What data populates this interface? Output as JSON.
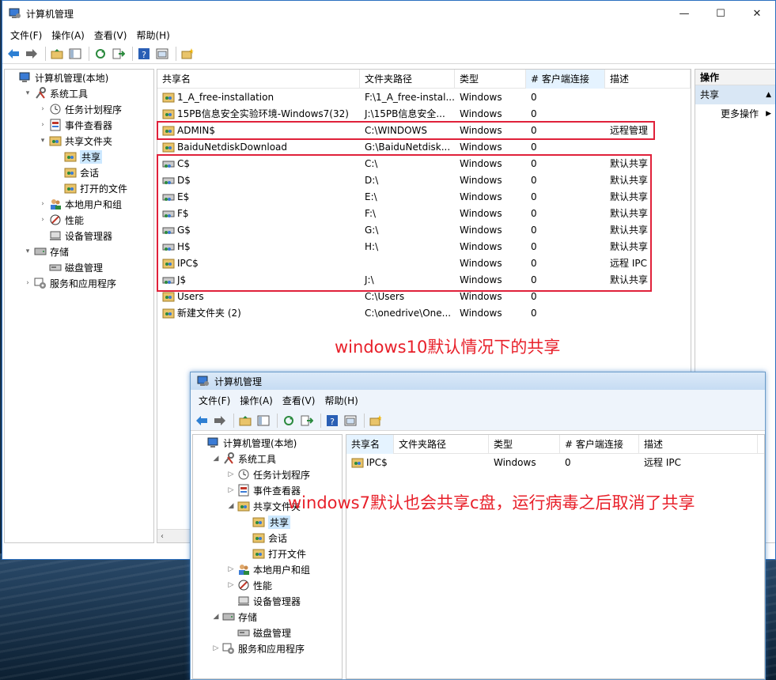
{
  "w10": {
    "title": "计算机管理",
    "menu": [
      "文件(F)",
      "操作(A)",
      "查看(V)",
      "帮助(H)"
    ],
    "tree": [
      {
        "label": "计算机管理(本地)",
        "indent": 0,
        "arrow": "",
        "icon": "computer"
      },
      {
        "label": "系统工具",
        "indent": 1,
        "arrow": "▾",
        "icon": "tools"
      },
      {
        "label": "任务计划程序",
        "indent": 2,
        "arrow": "›",
        "icon": "clock"
      },
      {
        "label": "事件查看器",
        "indent": 2,
        "arrow": "›",
        "icon": "event"
      },
      {
        "label": "共享文件夹",
        "indent": 2,
        "arrow": "▾",
        "icon": "share"
      },
      {
        "label": "共享",
        "indent": 3,
        "arrow": "",
        "icon": "share",
        "selected": true
      },
      {
        "label": "会话",
        "indent": 3,
        "arrow": "",
        "icon": "share"
      },
      {
        "label": "打开的文件",
        "indent": 3,
        "arrow": "",
        "icon": "share"
      },
      {
        "label": "本地用户和组",
        "indent": 2,
        "arrow": "›",
        "icon": "users"
      },
      {
        "label": "性能",
        "indent": 2,
        "arrow": "›",
        "icon": "perf"
      },
      {
        "label": "设备管理器",
        "indent": 2,
        "arrow": "",
        "icon": "device"
      },
      {
        "label": "存储",
        "indent": 1,
        "arrow": "▾",
        "icon": "storage"
      },
      {
        "label": "磁盘管理",
        "indent": 2,
        "arrow": "",
        "icon": "disk"
      },
      {
        "label": "服务和应用程序",
        "indent": 1,
        "arrow": "›",
        "icon": "services"
      }
    ],
    "columns": [
      "共享名",
      "文件夹路径",
      "类型",
      "# 客户端连接",
      "描述"
    ],
    "rows": [
      [
        "1_A_free-installation",
        "F:\\1_A_free-instal...",
        "Windows",
        "0",
        ""
      ],
      [
        "15PB信息安全实验环境-Windows7(32)",
        "J:\\15PB信息安全...",
        "Windows",
        "0",
        ""
      ],
      [
        "ADMIN$",
        "C:\\WINDOWS",
        "Windows",
        "0",
        "远程管理"
      ],
      [
        "BaiduNetdiskDownload",
        "G:\\BaiduNetdisk...",
        "Windows",
        "0",
        ""
      ],
      [
        "C$",
        "C:\\",
        "Windows",
        "0",
        "默认共享"
      ],
      [
        "D$",
        "D:\\",
        "Windows",
        "0",
        "默认共享"
      ],
      [
        "E$",
        "E:\\",
        "Windows",
        "0",
        "默认共享"
      ],
      [
        "F$",
        "F:\\",
        "Windows",
        "0",
        "默认共享"
      ],
      [
        "G$",
        "G:\\",
        "Windows",
        "0",
        "默认共享"
      ],
      [
        "H$",
        "H:\\",
        "Windows",
        "0",
        "默认共享"
      ],
      [
        "IPC$",
        "",
        "Windows",
        "0",
        "远程 IPC"
      ],
      [
        "J$",
        "J:\\",
        "Windows",
        "0",
        "默认共享"
      ],
      [
        "Users",
        "C:\\Users",
        "Windows",
        "0",
        ""
      ],
      [
        "新建文件夹 (2)",
        "C:\\onedrive\\One...",
        "Windows",
        "0",
        ""
      ]
    ],
    "actions": {
      "header": "操作",
      "section": "共享",
      "item": "更多操作"
    }
  },
  "w7": {
    "title": "计算机管理",
    "menu": [
      "文件(F)",
      "操作(A)",
      "查看(V)",
      "帮助(H)"
    ],
    "tree": [
      {
        "label": "计算机管理(本地)",
        "indent": 0,
        "arrow": "",
        "icon": "computer"
      },
      {
        "label": "系统工具",
        "indent": 1,
        "arrow": "◢",
        "icon": "tools"
      },
      {
        "label": "任务计划程序",
        "indent": 2,
        "arrow": "▷",
        "icon": "clock"
      },
      {
        "label": "事件查看器",
        "indent": 2,
        "arrow": "▷",
        "icon": "event"
      },
      {
        "label": "共享文件夹",
        "indent": 2,
        "arrow": "◢",
        "icon": "share"
      },
      {
        "label": "共享",
        "indent": 3,
        "arrow": "",
        "icon": "share",
        "selected": true
      },
      {
        "label": "会话",
        "indent": 3,
        "arrow": "",
        "icon": "share"
      },
      {
        "label": "打开文件",
        "indent": 3,
        "arrow": "",
        "icon": "share"
      },
      {
        "label": "本地用户和组",
        "indent": 2,
        "arrow": "▷",
        "icon": "users"
      },
      {
        "label": "性能",
        "indent": 2,
        "arrow": "▷",
        "icon": "perf"
      },
      {
        "label": "设备管理器",
        "indent": 2,
        "arrow": "",
        "icon": "device"
      },
      {
        "label": "存储",
        "indent": 1,
        "arrow": "◢",
        "icon": "storage"
      },
      {
        "label": "磁盘管理",
        "indent": 2,
        "arrow": "",
        "icon": "disk"
      },
      {
        "label": "服务和应用程序",
        "indent": 1,
        "arrow": "▷",
        "icon": "services"
      }
    ],
    "columns": [
      "共享名",
      "文件夹路径",
      "类型",
      "# 客户端连接",
      "描述"
    ],
    "rows": [
      [
        "IPC$",
        "",
        "Windows",
        "0",
        "远程 IPC"
      ]
    ]
  },
  "annotations": {
    "win10": "windows10默认情况下的共享",
    "win7": "windows7默认也会共享c盘，运行病毒之后取消了共享"
  },
  "colors": {
    "highlight": "#e0213a",
    "annotation": "#e8202a",
    "selection": "#cce8ff"
  }
}
